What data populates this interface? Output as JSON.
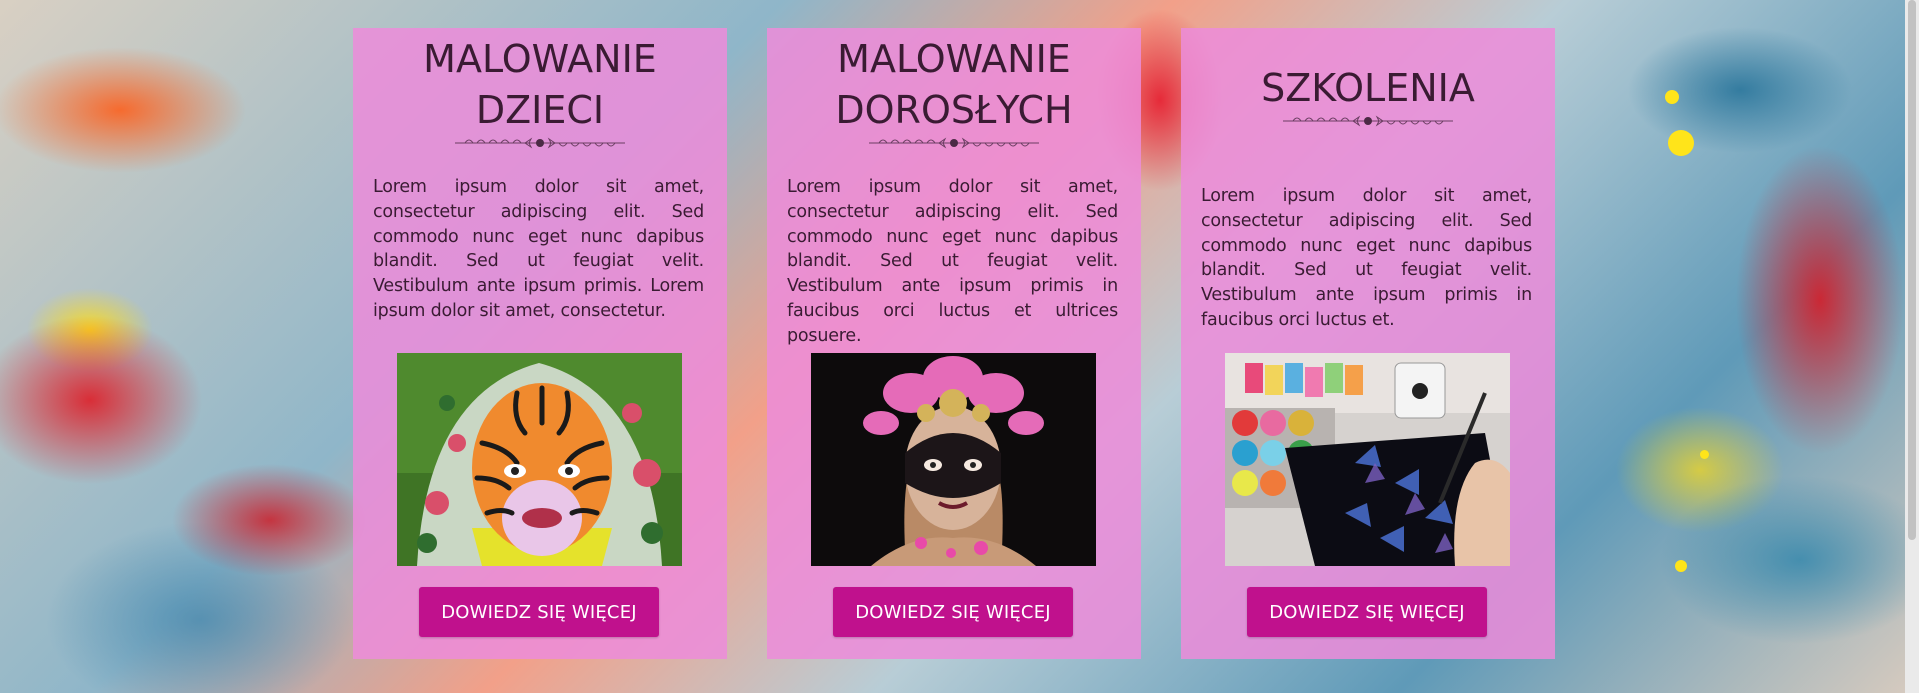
{
  "cards": [
    {
      "title_line1": "MALOWANIE",
      "title_line2": "DZIECI",
      "text": "Lorem ipsum dolor sit amet, consectetur adipiscing elit. Sed commodo nunc eget nunc dapibus blandit. Sed ut feugiat velit. Vestibulum ante ipsum primis. Lorem ipsum dolor sit amet, consectetur.",
      "button_label": "DOWIEDZ SIĘ WIĘCEJ",
      "image": "child-tiger-face-paint-photo"
    },
    {
      "title_line1": "MALOWANIE",
      "title_line2": "DOROSŁYCH",
      "text": "Lorem ipsum dolor sit amet, consectetur adipiscing elit. Sed commodo nunc eget nunc dapibus blandit. Sed ut feugiat velit. Vestibulum ante ipsum primis in faucibus orci luctus et ultrices posuere.",
      "button_label": "DOWIEDZ SIĘ WIĘCEJ",
      "image": "adult-fantasy-face-paint-photo"
    },
    {
      "title_line1": "SZKOLENIA",
      "text": "Lorem ipsum dolor sit amet, consectetur adipiscing elit. Sed commodo nunc eget nunc dapibus blandit. Sed ut feugiat velit. Vestibulum ante ipsum primis in faucibus orci luctus et.",
      "button_label": "DOWIEDZ SIĘ WIĘCEJ",
      "image": "face-paint-palette-training-photo"
    }
  ],
  "colors": {
    "card_background": "#ec8cda",
    "button_background": "#c0118d",
    "title_text": "#3a1b33"
  }
}
